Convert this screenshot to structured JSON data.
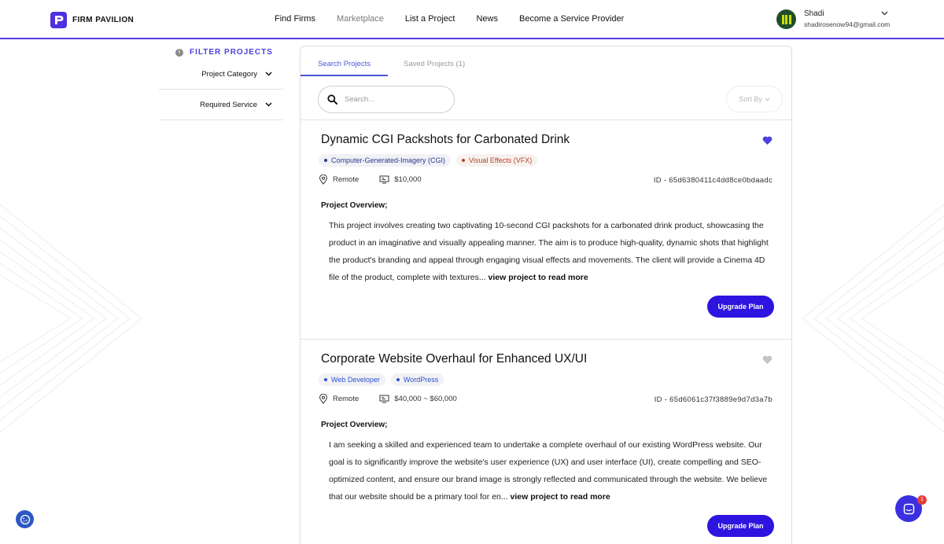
{
  "header": {
    "logo_text": "FIRM PAVILION",
    "nav": [
      {
        "label": "Find Firms"
      },
      {
        "label": "Marketplace"
      },
      {
        "label": "List a Project"
      },
      {
        "label": "News"
      },
      {
        "label": "Become a Service Provider"
      }
    ],
    "user": {
      "name": "Shadi",
      "email": "shadirosenow94@gmail.com"
    }
  },
  "sidebar": {
    "title": "FILTER PROJECTS",
    "filters": [
      {
        "label": "Project Category"
      },
      {
        "label": "Required Service"
      }
    ]
  },
  "main": {
    "tabs": [
      {
        "label": "Search Projects",
        "active": true
      },
      {
        "label": "Saved Projects (1)",
        "active": false
      }
    ],
    "search": {
      "placeholder": "Search...",
      "value": ""
    },
    "sort_label": "Sort By",
    "projects": [
      {
        "title": "Dynamic CGI Packshots for Carbonated Drink",
        "saved": true,
        "tags": [
          "Computer-Generated-Imagery (CGI)",
          "Visual Effects (VFX)"
        ],
        "location": "Remote",
        "budget": "$10,000",
        "id": "ID - 65d6380411c4dd8ce0bdaadc",
        "overview_label": "Project Overview;",
        "description": "This project involves creating two captivating 10-second CGI packshots for a carbonated drink product, showcasing the product in an imaginative and visually appealing manner. The aim is to produce high-quality, dynamic shots that highlight the product's branding and appeal through engaging visual effects and movements. The client will provide a Cinema 4D file of the product, complete with textures...",
        "read_more": "view project to read more",
        "button": "Upgrade Plan"
      },
      {
        "title": "Corporate Website Overhaul for Enhanced UX/UI",
        "saved": false,
        "tags": [
          "Web Developer",
          "WordPress"
        ],
        "location": "Remote",
        "budget": "$40,000 ~ $60,000",
        "id": "ID - 65d6061c37f3889e9d7d3a7b",
        "overview_label": "Project Overview;",
        "description": "I am seeking a skilled and experienced team to undertake a complete overhaul of our existing WordPress website. Our goal is to significantly improve the website's user experience (UX) and user interface (UI), create compelling and SEO-optimized content, and ensure our brand image is strongly reflected and communicated through the website. We believe that our website should be a primary tool for en...",
        "read_more": "view project to read more",
        "button": "Upgrade Plan"
      }
    ]
  },
  "widgets": {
    "chat_badge": "1"
  },
  "colors": {
    "accent": "#2d14e0",
    "brand": "#4f2fe0",
    "heart_saved": "#4f3fe0",
    "heart_unsaved": "#c4c4c4"
  }
}
